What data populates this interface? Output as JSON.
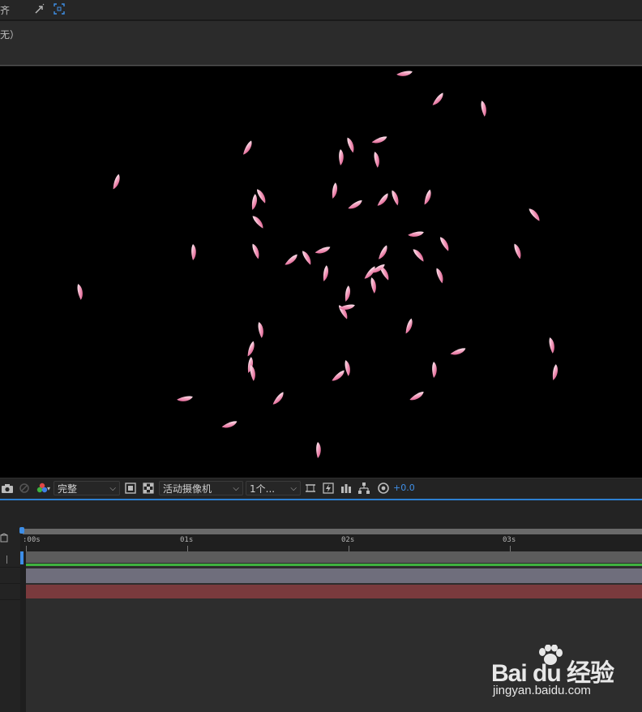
{
  "top_panel": {
    "align_label": "齐",
    "none_label": "无）",
    "icons": [
      "snap-icon",
      "expand-icon"
    ]
  },
  "viewer": {
    "background": "#000000",
    "petal_color": "#e0709a"
  },
  "viewer_toolbar": {
    "resolution": "完整",
    "camera": "活动摄像机",
    "views": "1个...",
    "exposure": "+0.0",
    "accent": "#3f8fe6"
  },
  "timeline": {
    "ruler_labels": [
      ":00s",
      "01s",
      "02s",
      "03s"
    ],
    "playhead_color": "#3d8ee8",
    "layer_colors": [
      "#6f6e7c",
      "#7a3a3d"
    ]
  },
  "watermark": {
    "logo": "Bai du 经验",
    "url": "jingyan.baidu.com"
  }
}
